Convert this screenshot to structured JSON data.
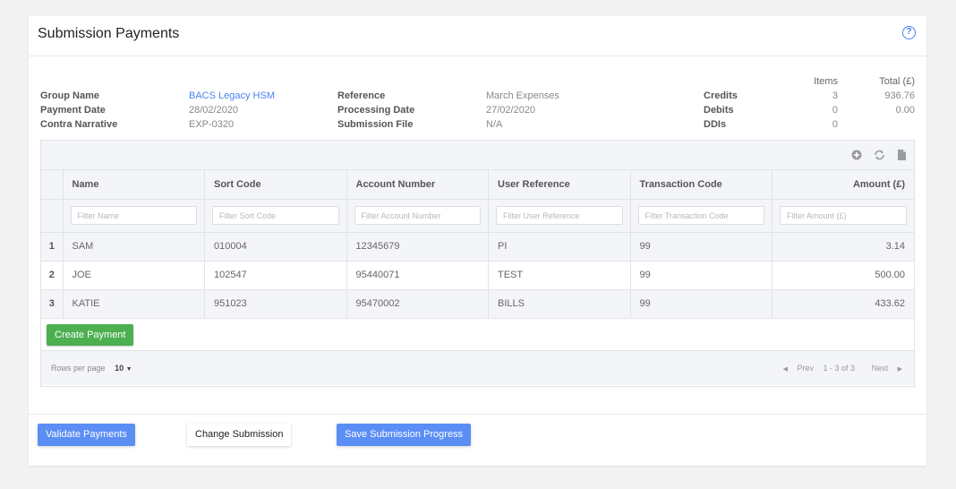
{
  "header": {
    "title": "Submission Payments",
    "help_icon": "question-circle-icon"
  },
  "info": {
    "col1": [
      {
        "label": "Group Name",
        "value": "BACS Legacy HSM"
      },
      {
        "label": "Payment Date",
        "value": "28/02/2020"
      },
      {
        "label": "Contra Narrative",
        "value": "EXP-0320"
      }
    ],
    "col2": [
      {
        "label": "Reference",
        "value": "March Expenses"
      },
      {
        "label": "Processing Date",
        "value": "27/02/2020"
      },
      {
        "label": "Submission File",
        "value": "N/A"
      }
    ]
  },
  "summary": {
    "headers": {
      "items": "Items",
      "total": "Total (£)"
    },
    "rows": [
      {
        "label": "Credits",
        "items": "3",
        "total": "936.76"
      },
      {
        "label": "Debits",
        "items": "0",
        "total": "0.00"
      },
      {
        "label": "DDIs",
        "items": "0",
        "total": ""
      }
    ]
  },
  "toolbar": {
    "icons": [
      "add-circle-icon",
      "refresh-icon",
      "file-icon"
    ]
  },
  "table": {
    "columns": [
      "Name",
      "Sort Code",
      "Account Number",
      "User Reference",
      "Transaction Code",
      "Amount (£)"
    ],
    "filters": [
      "Filter Name",
      "Filter Sort Code",
      "Filter Account Number",
      "Filter User Reference",
      "Filter Transaction Code",
      "Filter Amount (£)"
    ],
    "rows": [
      {
        "index": "1",
        "name": "SAM",
        "sort_code": "010004",
        "account_number": "12345679",
        "user_reference": "PI",
        "transaction_code": "99",
        "amount": "3.14"
      },
      {
        "index": "2",
        "name": "JOE",
        "sort_code": "102547",
        "account_number": "95440071",
        "user_reference": "TEST",
        "transaction_code": "99",
        "amount": "500.00"
      },
      {
        "index": "3",
        "name": "KATIE",
        "sort_code": "951023",
        "account_number": "95470002",
        "user_reference": "BILLS",
        "transaction_code": "99",
        "amount": "433.62"
      }
    ]
  },
  "create_payment_label": "Create Payment",
  "footer": {
    "rows_per_page_label": "Rows per page",
    "rows_per_page_value": "10",
    "prev_label": "Prev",
    "range_label": "1 - 3 of 3",
    "next_label": "Next"
  },
  "actions": {
    "validate": "Validate Payments",
    "change": "Change Submission",
    "save": "Save Submission Progress"
  },
  "colors": {
    "accent": "#5b8ef5",
    "link": "#4b82f0",
    "success": "#4caf50"
  }
}
